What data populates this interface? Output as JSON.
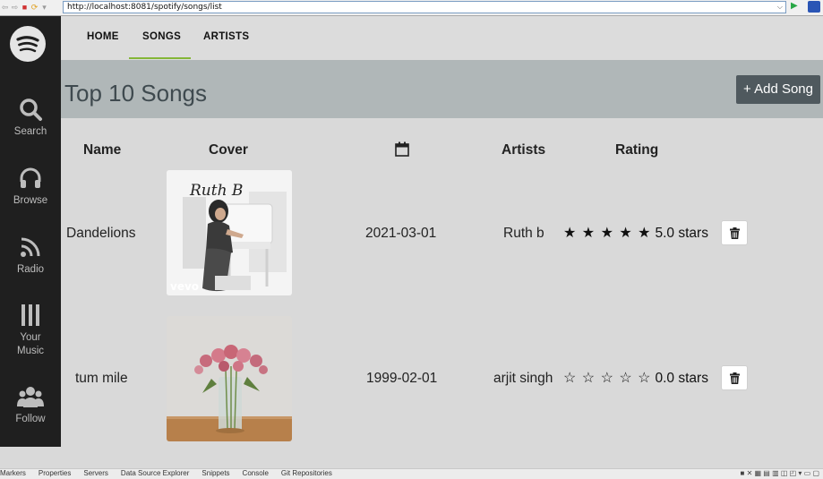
{
  "browser": {
    "url": "http://localhost:8081/spotify/songs/list",
    "nav_glyphs": [
      "⇦",
      "⇨",
      "■",
      "⟳",
      "▾"
    ]
  },
  "sidebar": {
    "items": [
      {
        "label": "Search",
        "icon": "search-icon"
      },
      {
        "label": "Browse",
        "icon": "headphones-icon"
      },
      {
        "label": "Radio",
        "icon": "radio-icon"
      },
      {
        "label": "Your Music",
        "icon": "library-icon"
      },
      {
        "label": "Follow",
        "icon": "group-icon"
      }
    ]
  },
  "nav": {
    "tabs": [
      "HOME",
      "SONGS",
      "ARTISTS"
    ],
    "active": "SONGS",
    "accent": "#84b637"
  },
  "header": {
    "title": "Top 10 Songs",
    "add_label": "+ Add Song"
  },
  "table": {
    "columns": {
      "name": "Name",
      "cover": "Cover",
      "date_icon": "calendar-icon",
      "artists": "Artists",
      "rating": "Rating"
    },
    "rows": [
      {
        "name": "Dandelions",
        "date": "2021-03-01",
        "artist": "Ruth b",
        "rating": 5,
        "stars_text": "★ ★ ★ ★ ★",
        "rating_label": "5.0 stars",
        "cover_text": "Ruth B",
        "cover_badge": "vevo"
      },
      {
        "name": "tum mile",
        "date": "1999-02-01",
        "artist": "arjit singh",
        "rating": 0,
        "stars_text": "☆ ☆ ☆ ☆ ☆",
        "rating_label": "0.0 stars"
      }
    ]
  },
  "taskbar": {
    "items": [
      "Markers",
      "Properties",
      "Servers",
      "Data Source Explorer",
      "Snippets",
      "Console",
      "Git Repositories"
    ]
  }
}
